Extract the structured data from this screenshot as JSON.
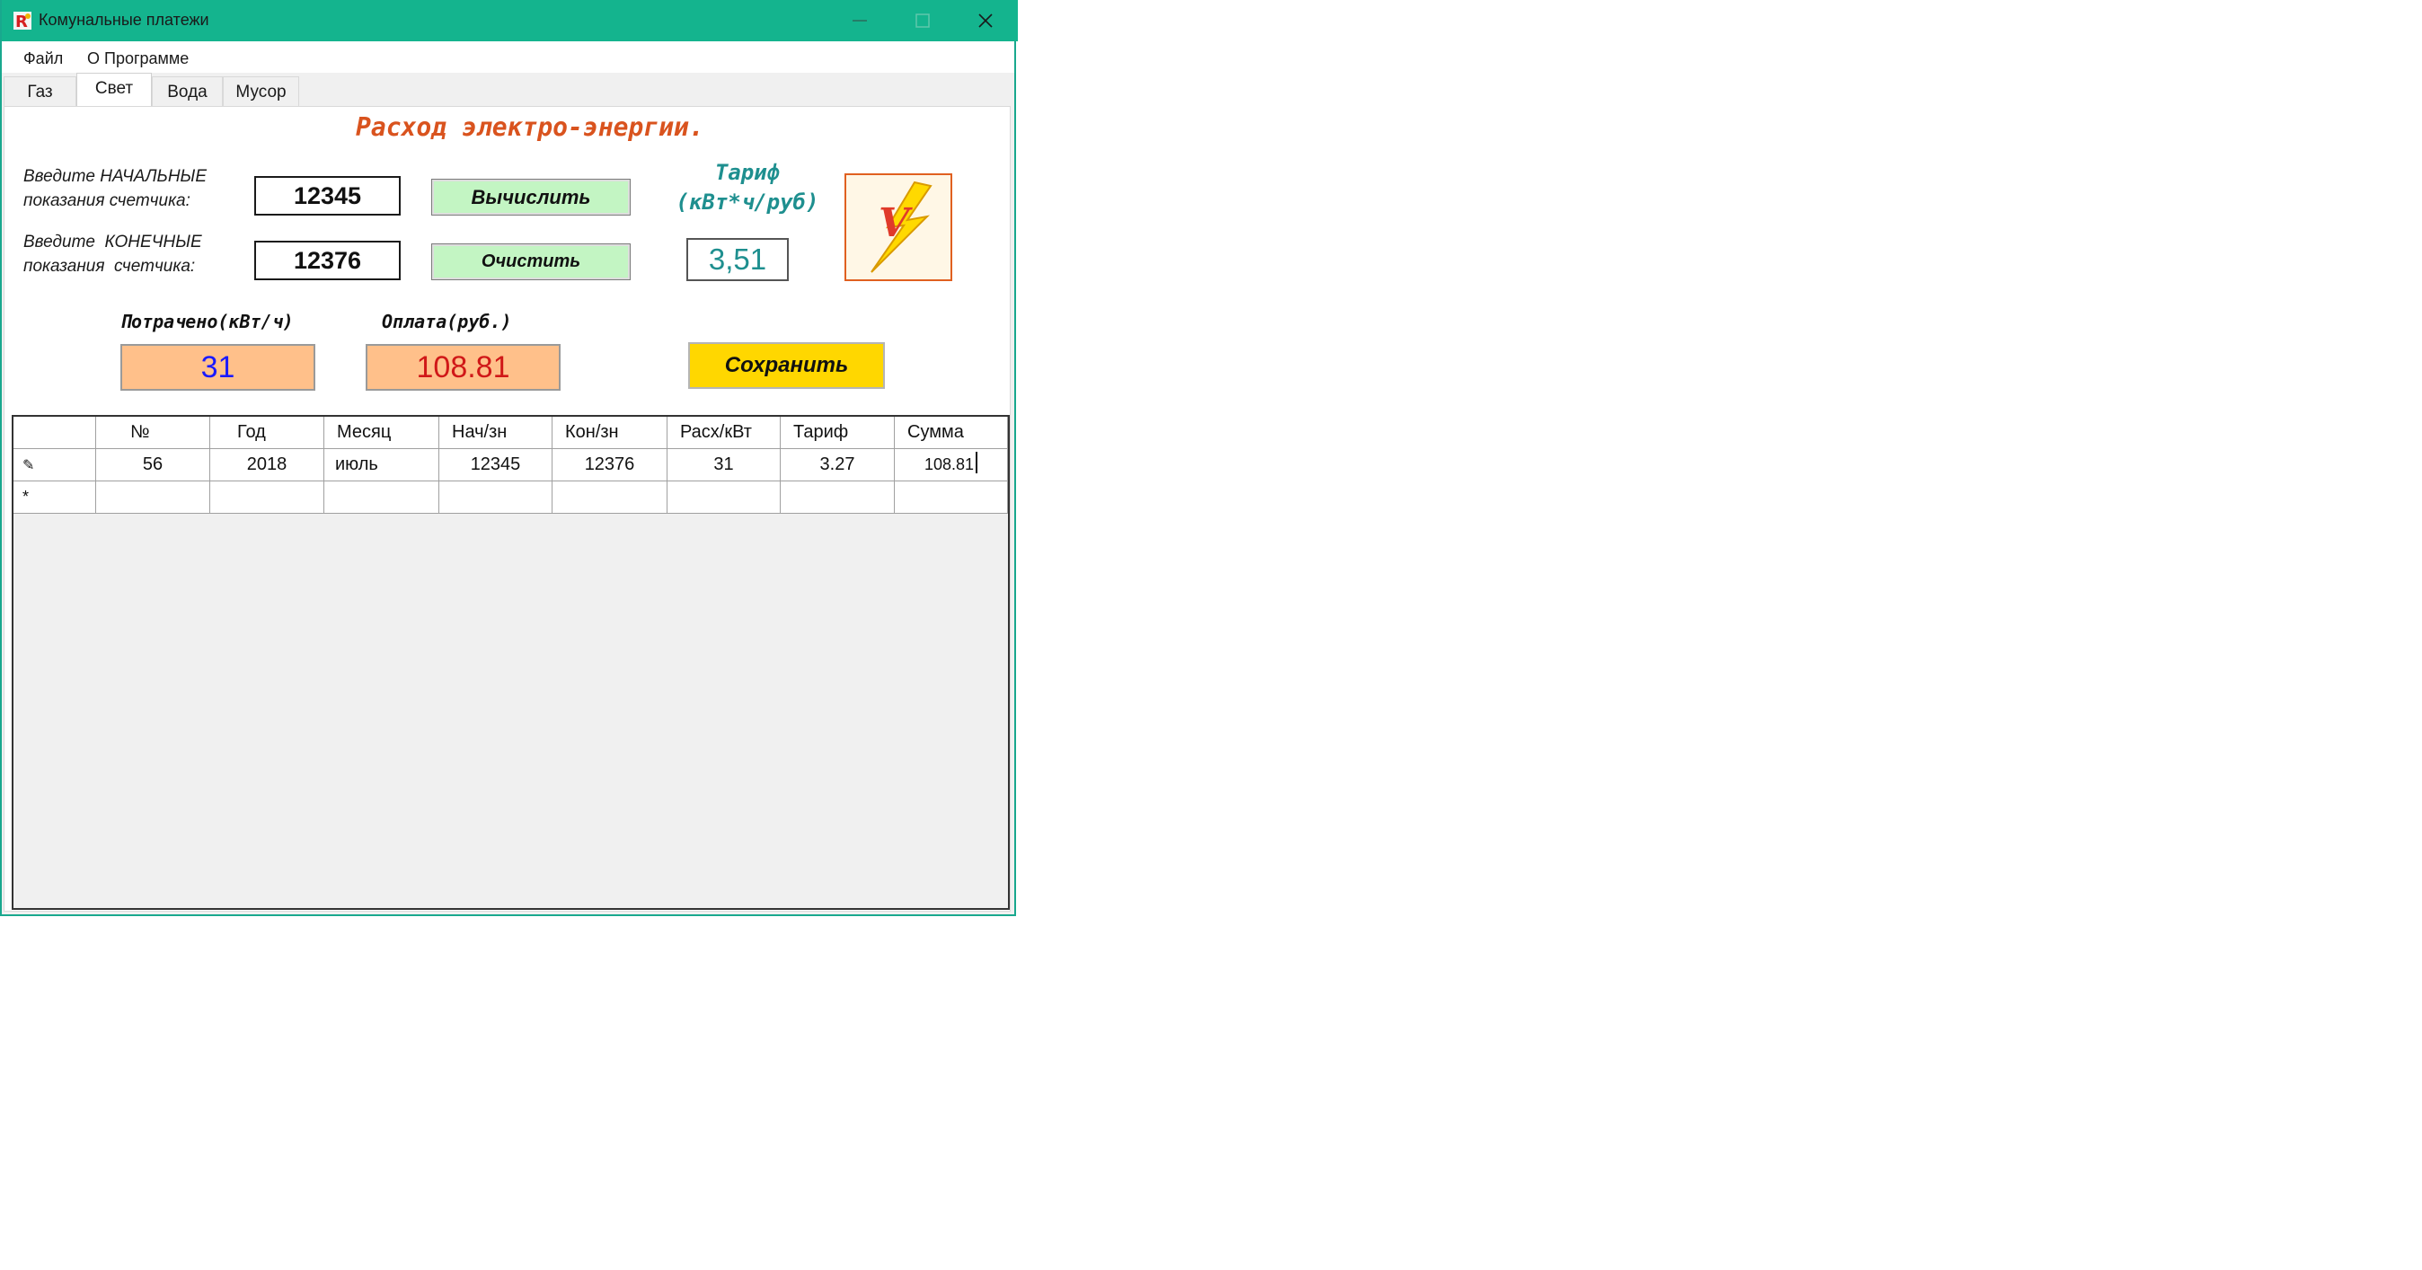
{
  "window": {
    "title": "Комунальные платежи"
  },
  "titlebar_buttons": {
    "minimize": "—",
    "maximize": "☐",
    "close": "✕"
  },
  "menu": [
    "Файл",
    "О Программе"
  ],
  "tabs": [
    "Газ",
    "Свет",
    "Вода",
    "Мусор"
  ],
  "active_tab": "Свет",
  "page": {
    "heading": "Расход электро-энергии.",
    "start_label_1": "Введите НАЧАЛЬНЫЕ",
    "start_label_2": "показания счетчика:",
    "end_label_1": "Введите  КОНЕЧНЫЕ",
    "end_label_2": "показания  счетчика:",
    "start_value": "12345",
    "end_value": "12376",
    "calc_button": "Вычислить",
    "clear_button": "Очистить",
    "tariff_label_1": "Тариф",
    "tariff_label_2": "(кВт*ч/руб)",
    "tariff_value": "3,51",
    "spent_label": "Потрачено(кВт/ч)",
    "spent_value": "31",
    "payment_label": "Оплата(руб.)",
    "payment_value": "108.81",
    "save_button": "Сохранить"
  },
  "table": {
    "columns": [
      "№",
      "Год",
      "Месяц",
      "Нач/зн",
      "Кон/зн",
      "Расх/кВт",
      "Тариф",
      "Сумма"
    ],
    "rows": [
      [
        "56",
        "2018",
        "июль",
        "12345",
        "12376",
        "31",
        "3.27",
        "108.81"
      ]
    ],
    "edit_marker": "✎",
    "new_row_marker": "*"
  },
  "colors": {
    "titlebar": "#14b48e",
    "heading": "#d9531e",
    "tariff": "#1e8f8f",
    "button_green": "#c3f5c3",
    "output_fill": "#ffc08a",
    "spent_text": "#1a1aff",
    "payment_text": "#d01818",
    "save_button": "#ffd700"
  }
}
